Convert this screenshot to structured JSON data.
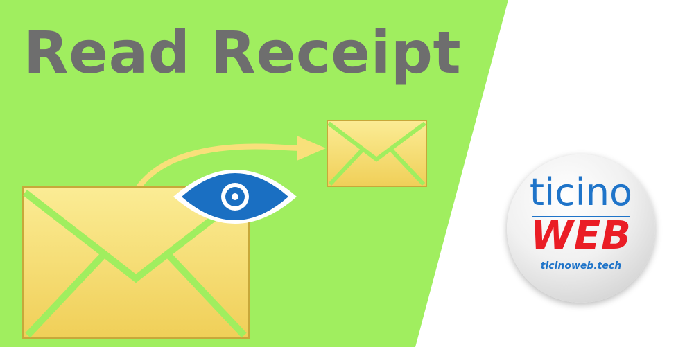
{
  "title": "Read Receipt",
  "logo": {
    "line1": "ticino",
    "line2": "WEB",
    "url": "ticinoweb.tech"
  },
  "colors": {
    "green_panel": "#a0ee5f",
    "envelope_fill": "#f7e07a",
    "eye_blue": "#1a6fc2",
    "arrow_yellow": "#f8e07a",
    "title_gray": "#6e6e6e",
    "logo_blue": "#1f74c9",
    "logo_red": "#ea1d25"
  },
  "icons": [
    "large-envelope-icon",
    "small-envelope-icon",
    "eye-icon",
    "curved-arrow-icon"
  ]
}
